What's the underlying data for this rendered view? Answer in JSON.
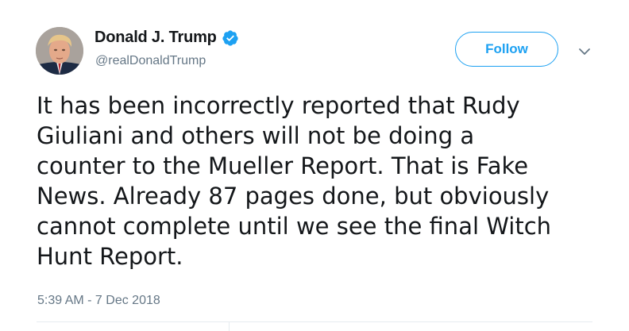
{
  "user": {
    "display_name": "Donald J. Trump",
    "handle": "@realDonaldTrump",
    "verified": true,
    "avatar_icon": "profile-photo"
  },
  "actions": {
    "follow_label": "Follow",
    "menu_icon": "chevron-down-icon"
  },
  "tweet": {
    "text": "It has been incorrectly reported that Rudy\nGiuliani and others will not be doing a\ncounter to the Mueller Report. That is Fake\nNews. Already 87 pages done, but obviously\ncannot complete until we see the final Witch\nHunt Report.",
    "timestamp": "5:39 AM - 7 Dec 2018"
  },
  "colors": {
    "accent": "#1da1f2",
    "text": "#14171a",
    "secondary": "#657786",
    "divider": "#e6ecf0"
  }
}
